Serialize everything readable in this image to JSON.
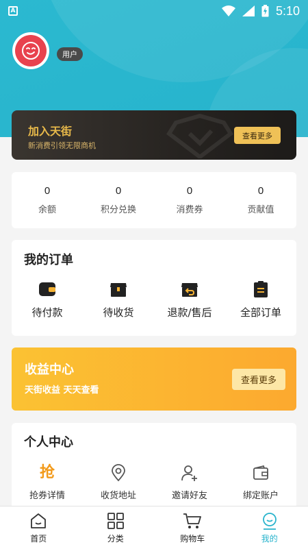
{
  "status_bar": {
    "time": "5:10",
    "app_badge": "A"
  },
  "profile": {
    "user_tag": "用户"
  },
  "vip": {
    "title": "加入天街",
    "subtitle": "新消费引领无限商机",
    "button": "查看更多"
  },
  "stats": [
    {
      "value": "0",
      "label": "余额"
    },
    {
      "value": "0",
      "label": "积分兑换"
    },
    {
      "value": "0",
      "label": "消费券"
    },
    {
      "value": "0",
      "label": "贡献值"
    }
  ],
  "orders": {
    "title": "我的订单",
    "items": [
      {
        "label": "待付款",
        "icon": "wallet-icon"
      },
      {
        "label": "待收货",
        "icon": "box-icon"
      },
      {
        "label": "退款/售后",
        "icon": "return-box-icon"
      },
      {
        "label": "全部订单",
        "icon": "clipboard-icon"
      }
    ]
  },
  "earnings": {
    "title": "收益中心",
    "subtitle": "天街收益 天天查看",
    "button": "查看更多"
  },
  "personal": {
    "title": "个人中心",
    "items": [
      {
        "label": "抢券详情",
        "glyph": "抢",
        "icon": "grab-coupon-icon"
      },
      {
        "label": "收货地址",
        "icon": "location-pin-icon"
      },
      {
        "label": "邀请好友",
        "icon": "add-user-icon"
      },
      {
        "label": "绑定账户",
        "icon": "wallet-outline-icon"
      }
    ]
  },
  "tabbar": {
    "items": [
      {
        "label": "首页",
        "icon": "home-icon"
      },
      {
        "label": "分类",
        "icon": "grid-icon"
      },
      {
        "label": "购物车",
        "icon": "cart-icon"
      },
      {
        "label": "我的",
        "icon": "profile-icon",
        "active": true
      }
    ]
  },
  "colors": {
    "primary": "#27b3cc",
    "gold": "#e8b94a",
    "orange": "#fca92f",
    "avatar": "#e8424e"
  }
}
